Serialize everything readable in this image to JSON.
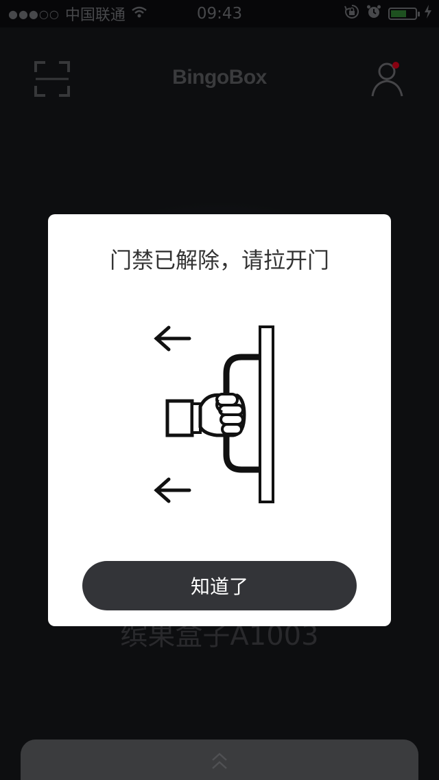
{
  "status_bar": {
    "signal": "●●●○○",
    "carrier": "中国联通",
    "time": "09:43",
    "battery_level_percent": 65,
    "icons": [
      "wifi-icon",
      "rotation-lock-icon",
      "alarm-icon",
      "battery-icon",
      "charging-icon"
    ]
  },
  "header": {
    "title": "BingoBox",
    "left_icon": "scan-icon",
    "right_icon": "profile-icon",
    "notification_dot_color": "#d0021b"
  },
  "background": {
    "device_name": "缤果盒子A1003",
    "panel_icon": "chevron-up-icon"
  },
  "modal": {
    "title": "门禁已解除，请拉开门",
    "illustration": "pull-door-icon",
    "confirm_label": "知道了"
  },
  "colors": {
    "background": "#151619",
    "modal": "#ffffff",
    "button": "#333438",
    "battery": "#2e7d32"
  }
}
